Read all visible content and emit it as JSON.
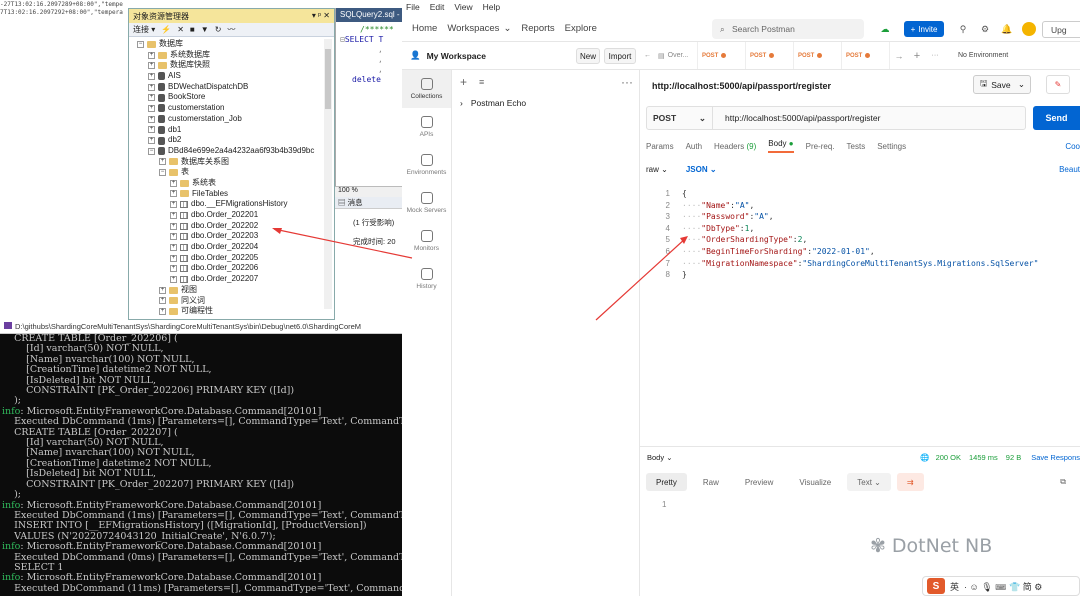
{
  "left_strip": {
    "lines": [
      "-27T13:02:16.2097289+08:00\",\"tempe",
      "7T13:02:16.2097292+08:00\",\"tempera"
    ]
  },
  "ssms": {
    "title": "对象资源管理器",
    "title_controls": "▾ ᵖ ✕",
    "toolbar": {
      "connect_label": "连接 ▾"
    },
    "tree": [
      {
        "depth": 0,
        "toggle": "−",
        "icon": "folder",
        "label": "数据库"
      },
      {
        "depth": 1,
        "toggle": "+",
        "icon": "folder",
        "label": "系统数据库"
      },
      {
        "depth": 1,
        "toggle": "+",
        "icon": "folder",
        "label": "数据库快照"
      },
      {
        "depth": 1,
        "toggle": "+",
        "icon": "db",
        "label": "AIS"
      },
      {
        "depth": 1,
        "toggle": "+",
        "icon": "db",
        "label": "BDWechatDispatchDB"
      },
      {
        "depth": 1,
        "toggle": "+",
        "icon": "db",
        "label": "BookStore"
      },
      {
        "depth": 1,
        "toggle": "+",
        "icon": "db",
        "label": "customerstation"
      },
      {
        "depth": 1,
        "toggle": "+",
        "icon": "db",
        "label": "customerstation_Job"
      },
      {
        "depth": 1,
        "toggle": "+",
        "icon": "db",
        "label": "db1"
      },
      {
        "depth": 1,
        "toggle": "+",
        "icon": "db",
        "label": "db2"
      },
      {
        "depth": 1,
        "toggle": "−",
        "icon": "db",
        "label": "DBd84e699e2a4a4232aa6f93b4b39d9bc"
      },
      {
        "depth": 2,
        "toggle": "+",
        "icon": "folder",
        "label": "数据库关系图"
      },
      {
        "depth": 2,
        "toggle": "−",
        "icon": "folder",
        "label": "表"
      },
      {
        "depth": 3,
        "toggle": "+",
        "icon": "folder",
        "label": "系统表"
      },
      {
        "depth": 3,
        "toggle": "+",
        "icon": "folder",
        "label": "FileTables"
      },
      {
        "depth": 3,
        "toggle": "+",
        "icon": "table",
        "label": "dbo.__EFMigrationsHistory"
      },
      {
        "depth": 3,
        "toggle": "+",
        "icon": "table",
        "label": "dbo.Order_202201"
      },
      {
        "depth": 3,
        "toggle": "+",
        "icon": "table",
        "label": "dbo.Order_202202"
      },
      {
        "depth": 3,
        "toggle": "+",
        "icon": "table",
        "label": "dbo.Order_202203"
      },
      {
        "depth": 3,
        "toggle": "+",
        "icon": "table",
        "label": "dbo.Order_202204"
      },
      {
        "depth": 3,
        "toggle": "+",
        "icon": "table",
        "label": "dbo.Order_202205"
      },
      {
        "depth": 3,
        "toggle": "+",
        "icon": "table",
        "label": "dbo.Order_202206"
      },
      {
        "depth": 3,
        "toggle": "+",
        "icon": "table",
        "label": "dbo.Order_202207"
      },
      {
        "depth": 2,
        "toggle": "+",
        "icon": "folder",
        "label": "视图"
      },
      {
        "depth": 2,
        "toggle": "+",
        "icon": "folder",
        "label": "同义词"
      },
      {
        "depth": 2,
        "toggle": "+",
        "icon": "folder",
        "label": "可编程性"
      }
    ]
  },
  "query": {
    "tab_label": "SQLQuery2.sql -",
    "code_lines": [
      "/******",
      "SELECT T",
      ",",
      ",",
      ",",
      "delete"
    ],
    "zoom": "100 %",
    "results_tab": "消息",
    "message": "(1 行受影响)",
    "completed_label": "完成时间: 20"
  },
  "console": {
    "title": "D:\\githubs\\ShardingCoreMultiTenantSys\\ShardingCoreMultiTenantSys\\bin\\Debug\\net6.0\\ShardingCoreM",
    "lines": [
      {
        "t": "    CREATE TABLE [Order_202206] (",
        "info": false
      },
      {
        "t": "        [Id] varchar(50) NOT NULL,",
        "info": false
      },
      {
        "t": "        [Name] nvarchar(100) NOT NULL,",
        "info": false
      },
      {
        "t": "        [CreationTime] datetime2 NOT NULL,",
        "info": false
      },
      {
        "t": "        [IsDeleted] bit NOT NULL,",
        "info": false
      },
      {
        "t": "        CONSTRAINT [PK_Order_202206] PRIMARY KEY ([Id])",
        "info": false
      },
      {
        "t": "    );",
        "info": false
      },
      {
        "t": "info: Microsoft.EntityFrameworkCore.Database.Command[20101]",
        "info": true
      },
      {
        "t": "    Executed DbCommand (1ms) [Parameters=[], CommandType='Text', CommandTime",
        "info": false
      },
      {
        "t": "    CREATE TABLE [Order_202207] (",
        "info": false
      },
      {
        "t": "        [Id] varchar(50) NOT NULL,",
        "info": false
      },
      {
        "t": "        [Name] nvarchar(100) NOT NULL,",
        "info": false
      },
      {
        "t": "        [CreationTime] datetime2 NOT NULL,",
        "info": false
      },
      {
        "t": "        [IsDeleted] bit NOT NULL,",
        "info": false
      },
      {
        "t": "        CONSTRAINT [PK_Order_202207] PRIMARY KEY ([Id])",
        "info": false
      },
      {
        "t": "    );",
        "info": false
      },
      {
        "t": "info: Microsoft.EntityFrameworkCore.Database.Command[20101]",
        "info": true
      },
      {
        "t": "    Executed DbCommand (1ms) [Parameters=[], CommandType='Text', CommandTime",
        "info": false
      },
      {
        "t": "    INSERT INTO [__EFMigrationsHistory] ([MigrationId], [ProductVersion])",
        "info": false
      },
      {
        "t": "    VALUES (N'20220724043120_InitialCreate', N'6.0.7');",
        "info": false
      },
      {
        "t": "info: Microsoft.EntityFrameworkCore.Database.Command[20101]",
        "info": true
      },
      {
        "t": "    Executed DbCommand (0ms) [Parameters=[], CommandType='Text', CommandTime",
        "info": false
      },
      {
        "t": "    SELECT 1",
        "info": false
      },
      {
        "t": "info: Microsoft.EntityFrameworkCore.Database.Command[20101]",
        "info": true
      },
      {
        "t": "    Executed DbCommand (11ms) [Parameters=[], CommandType='Text', CommandTim",
        "info": false
      }
    ]
  },
  "postman": {
    "menu": [
      "File",
      "Edit",
      "View",
      "Help"
    ],
    "nav": {
      "home": "Home",
      "workspaces": "Workspaces",
      "reports": "Reports",
      "explore": "Explore"
    },
    "search_placeholder": "Search Postman",
    "invite_label": "Invite",
    "upgrade_label": "Upg",
    "workspace_name": "My Workspace",
    "new_label": "New",
    "import_label": "Import",
    "rail": [
      {
        "label": "Collections",
        "icon": "collections-icon",
        "active": true
      },
      {
        "label": "APIs",
        "icon": "apis-icon",
        "active": false
      },
      {
        "label": "Environments",
        "icon": "environments-icon",
        "active": false
      },
      {
        "label": "Mock Servers",
        "icon": "mock-servers-icon",
        "active": false
      },
      {
        "label": "Monitors",
        "icon": "monitors-icon",
        "active": false
      },
      {
        "label": "History",
        "icon": "history-icon",
        "active": false
      }
    ],
    "collection_item": "Postman Echo",
    "tabs": {
      "overview": "Over...",
      "req_tabs": [
        "POST",
        "POST",
        "POST",
        "POST"
      ],
      "environment": "No Environment"
    },
    "request_title": "http://localhost:5000/api/passport/register",
    "save_label": "Save",
    "method": "POST",
    "url": "http://localhost:5000/api/passport/register",
    "send_label": "Send",
    "subtabs": {
      "params": "Params",
      "auth": "Auth",
      "headers": "Headers",
      "headers_count": "(9)",
      "body": "Body",
      "prerequest": "Pre-req.",
      "tests": "Tests",
      "settings": "Settings",
      "cookies": "Coo"
    },
    "body_mode": "raw",
    "body_lang": "JSON",
    "beautify": "Beaut",
    "body_lines": [
      {
        "n": "1",
        "parts": [
          {
            "c": "p",
            "t": "{"
          }
        ]
      },
      {
        "n": "2",
        "parts": [
          {
            "c": "dt",
            "t": "····"
          },
          {
            "c": "k",
            "t": "\"Name\""
          },
          {
            "c": "p",
            "t": ":"
          },
          {
            "c": "s",
            "t": "\"A\""
          },
          {
            "c": "p",
            "t": ","
          }
        ]
      },
      {
        "n": "3",
        "parts": [
          {
            "c": "dt",
            "t": "····"
          },
          {
            "c": "k",
            "t": "\"Password\""
          },
          {
            "c": "p",
            "t": ":"
          },
          {
            "c": "s",
            "t": "\"A\""
          },
          {
            "c": "p",
            "t": ","
          }
        ]
      },
      {
        "n": "4",
        "parts": [
          {
            "c": "dt",
            "t": "····"
          },
          {
            "c": "k",
            "t": "\"DbType\""
          },
          {
            "c": "p",
            "t": ":"
          },
          {
            "c": "n",
            "t": "1"
          },
          {
            "c": "p",
            "t": ","
          }
        ]
      },
      {
        "n": "5",
        "parts": [
          {
            "c": "dt",
            "t": "····"
          },
          {
            "c": "k",
            "t": "\"OrderShardingType\""
          },
          {
            "c": "p",
            "t": ":"
          },
          {
            "c": "n",
            "t": "2"
          },
          {
            "c": "p",
            "t": ","
          }
        ]
      },
      {
        "n": "6",
        "parts": [
          {
            "c": "dt",
            "t": "····"
          },
          {
            "c": "k",
            "t": "\"BeginTimeForSharding\""
          },
          {
            "c": "p",
            "t": ":"
          },
          {
            "c": "s",
            "t": "\"2022-01-01\""
          },
          {
            "c": "p",
            "t": ","
          }
        ]
      },
      {
        "n": "7",
        "parts": [
          {
            "c": "dt",
            "t": "····"
          },
          {
            "c": "k",
            "t": "\"MigrationNamespace\""
          },
          {
            "c": "p",
            "t": ":"
          },
          {
            "c": "s",
            "t": "\"ShardingCoreMultiTenantSys.Migrations.SqlServer\""
          }
        ]
      },
      {
        "n": "8",
        "parts": [
          {
            "c": "p",
            "t": "}"
          }
        ]
      }
    ],
    "response": {
      "label": "Body",
      "status": "200 OK",
      "time": "1459 ms",
      "size": "92 B",
      "save_response": "Save Respons",
      "tabs": {
        "pretty": "Pretty",
        "raw": "Raw",
        "preview": "Preview",
        "visualize": "Visualize",
        "text": "Text"
      },
      "line_no": "1"
    }
  },
  "watermark": "DotNet NB",
  "ime": {
    "logo": "S",
    "mode": "英",
    "chars": "· ☺ 🎙 ⌨ 👕 简 ⚙"
  },
  "colors": {
    "accent": "#0265d2",
    "post": "#e57a3a",
    "ok": "#1b9e3a",
    "arrow": "#e53935"
  }
}
